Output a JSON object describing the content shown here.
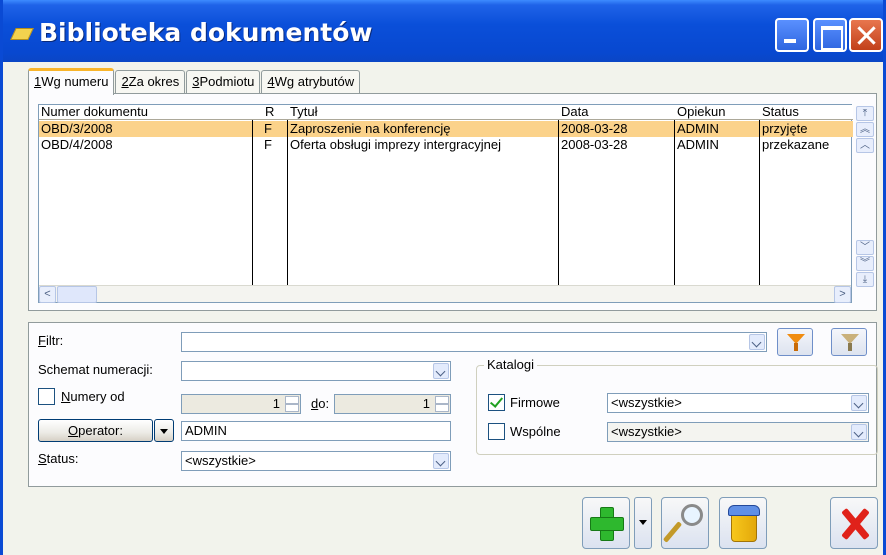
{
  "window": {
    "title": "Biblioteka dokumentów"
  },
  "tabs": [
    {
      "key": "1",
      "label": "Wg numeru"
    },
    {
      "key": "2",
      "label": "Za okres"
    },
    {
      "key": "3",
      "label": "Podmiotu"
    },
    {
      "key": "4",
      "label": "Wg atrybutów"
    }
  ],
  "grid": {
    "headers": [
      "Numer dokumentu",
      "R",
      "Tytuł",
      "Data",
      "Opiekun",
      "Status"
    ],
    "rows": [
      [
        "OBD/3/2008",
        "F",
        "Zaproszenie na konferencję",
        "2008-03-28",
        "ADMIN",
        "przyjęte"
      ],
      [
        "OBD/4/2008",
        "F",
        "Oferta obsługi imprezy intergracyjnej",
        "2008-03-28",
        "ADMIN",
        "przekazane"
      ]
    ],
    "selected_row": 0
  },
  "filter": {
    "filtr_label_key": "F",
    "filtr_label_rest": "iltr:",
    "filtr_value": "",
    "schemat_label": "Schemat numeracji:",
    "schemat_value": "",
    "numery_od_key": "N",
    "numery_od_rest": "umery od",
    "numery_od_checked": false,
    "numer_od_value": "1",
    "do_key": "d",
    "do_rest": "o:",
    "numer_do_value": "1",
    "operator_key": "O",
    "operator_rest": "perator:",
    "operator_value": "ADMIN",
    "status_key": "S",
    "status_rest": "tatus:",
    "status_value": "<wszystkie>"
  },
  "katalogi": {
    "legend": "Katalogi",
    "firmowe_label": "Firmowe",
    "firmowe_checked": true,
    "firmowe_value": "<wszystkie>",
    "wspolne_label": "Wspólne",
    "wspolne_checked": false,
    "wspolne_value": "<wszystkie>"
  }
}
